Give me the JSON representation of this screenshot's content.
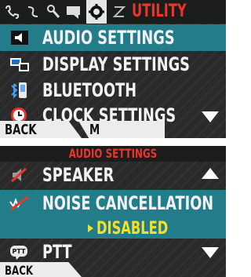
{
  "screen1": {
    "title": "UTILITY",
    "tabs": [
      "phone-icon",
      "audio-wave-icon",
      "wrench-icon",
      "chat-icon",
      "gear-icon",
      "signal-icon"
    ],
    "items": [
      {
        "label": "AUDIO SETTINGS",
        "icon": "speaker-icon",
        "selected": true
      },
      {
        "label": "DISPLAY SETTINGS",
        "icon": "display-icon",
        "selected": false
      },
      {
        "label": "BLUETOOTH",
        "icon": "bluetooth-icon",
        "selected": false
      },
      {
        "label": "CLOCK SETTINGS",
        "icon": "clock-icon",
        "selected": false
      }
    ],
    "softkey_left": "BACK",
    "softkey_mid": "M"
  },
  "screen2": {
    "title": "AUDIO SETTINGS",
    "items": [
      {
        "label": "SPEAKER",
        "icon": "speaker-muted-icon",
        "selected": false
      },
      {
        "label": "NOISE CANCELLATION",
        "icon": "noise-cancel-icon",
        "selected": true,
        "value": "DISABLED"
      },
      {
        "label": "PTT",
        "icon": "ptt-icon",
        "selected": false
      }
    ],
    "softkey_left": "BACK"
  },
  "colors": {
    "accent": "#e8372a",
    "selection": "#237c8a",
    "value": "#f6df2a",
    "background": "#2a2a2a"
  }
}
